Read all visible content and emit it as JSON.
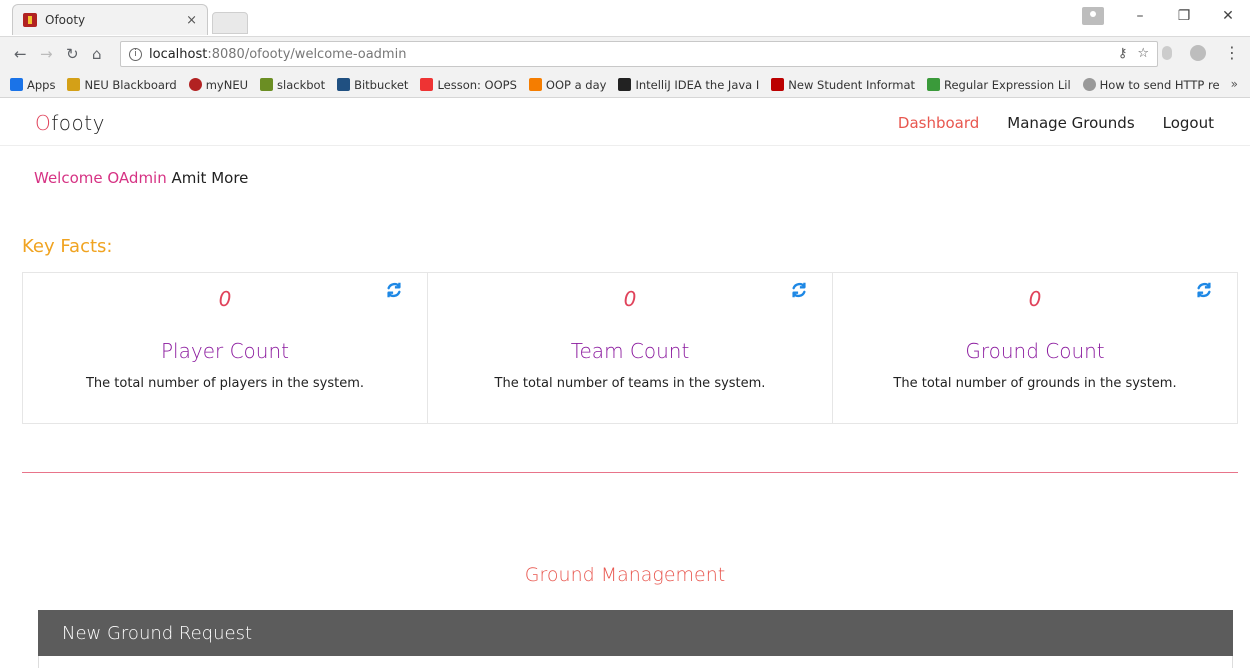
{
  "browser": {
    "tab_title": "Ofooty",
    "tab_close": "×",
    "url_host": "localhost",
    "url_rest": ":8080/ofooty/welcome-oadmin",
    "bookmarks": [
      {
        "label": "Apps",
        "color": "#1a73e8"
      },
      {
        "label": "NEU Blackboard",
        "color": "#d4a017"
      },
      {
        "label": "myNEU",
        "color": "#b22222"
      },
      {
        "label": "slackbot",
        "color": "#6b8e23"
      },
      {
        "label": "Bitbucket",
        "color": "#205081"
      },
      {
        "label": "Lesson: OOPS",
        "color": "#e33"
      },
      {
        "label": "OOP a day",
        "color": "#f57d00"
      },
      {
        "label": "IntelliJ IDEA the Java I",
        "color": "#222"
      },
      {
        "label": "New Student Informat",
        "color": "#b00"
      },
      {
        "label": "Regular Expression Lil",
        "color": "#3a9a3a"
      },
      {
        "label": "How to send HTTP re",
        "color": "#999"
      }
    ],
    "bookmarks_more": "»"
  },
  "site": {
    "brand_o": "O",
    "brand_rest": "footy",
    "nav": {
      "dashboard": "Dashboard",
      "manage_grounds": "Manage Grounds",
      "logout": "Logout"
    },
    "welcome_prefix": "Welcome OAdmin",
    "welcome_name": "Amit More",
    "key_facts": "Key Facts:",
    "cards": [
      {
        "value": "0",
        "title": "Player Count",
        "desc": "The total number of players in the system."
      },
      {
        "value": "0",
        "title": "Team Count",
        "desc": "The total number of teams in the system."
      },
      {
        "value": "0",
        "title": "Ground Count",
        "desc": "The total number of grounds in the system."
      }
    ],
    "section_title": "Ground Management",
    "panel_title": "New Ground Request"
  },
  "colors": {
    "accent_pink": "#e0435b",
    "purple": "#8b1a9e",
    "gold": "#f0a320",
    "refresh_blue": "#1e88e5",
    "panel_gray": "#5c5c5c"
  }
}
